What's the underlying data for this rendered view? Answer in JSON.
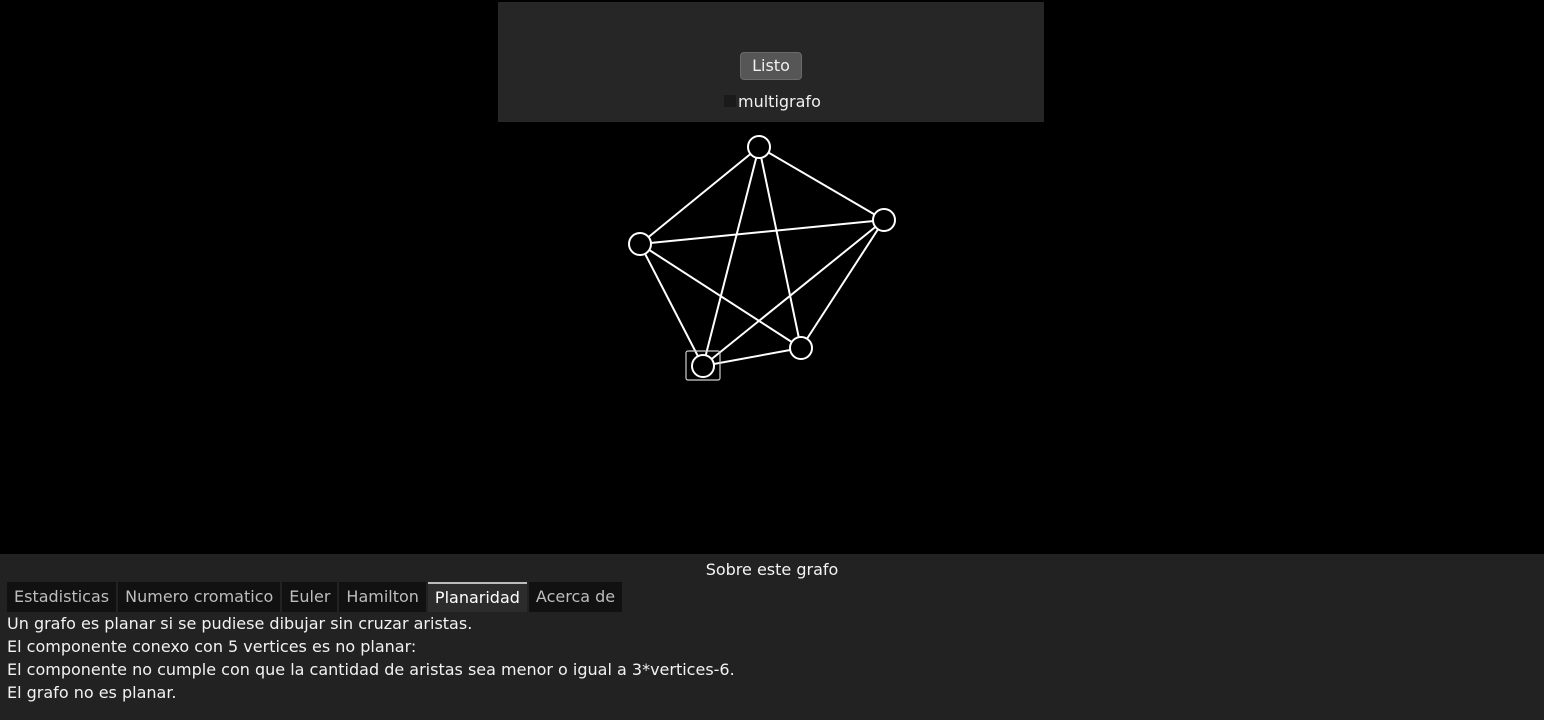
{
  "top_panel": {
    "done_button_label": "Listo",
    "multigraph_label": "multigrafo",
    "multigraph_checked": false
  },
  "bottom_panel": {
    "title": "Sobre este grafo",
    "tabs": [
      {
        "label": "Estadisticas",
        "active": false
      },
      {
        "label": "Numero cromatico",
        "active": false
      },
      {
        "label": "Euler",
        "active": false
      },
      {
        "label": "Hamilton",
        "active": false
      },
      {
        "label": "Planaridad",
        "active": true
      },
      {
        "label": "Acerca de",
        "active": false
      }
    ],
    "content_lines": [
      "Un grafo es planar si se pudiese dibujar sin cruzar aristas.",
      "El componente conexo con 5 vertices es no planar:",
      "El componente no cumple con que la cantidad de aristas sea menor o igual a 3*vertices-6.",
      "El grafo no es planar."
    ]
  },
  "graph": {
    "vertex_count": 5,
    "edges": [
      [
        0,
        1
      ],
      [
        0,
        2
      ],
      [
        0,
        3
      ],
      [
        0,
        4
      ],
      [
        1,
        2
      ],
      [
        1,
        3
      ],
      [
        1,
        4
      ],
      [
        2,
        3
      ],
      [
        2,
        4
      ],
      [
        3,
        4
      ]
    ],
    "selected_vertex": 3,
    "colors": {
      "background": "#000000",
      "edge": "#ffffff",
      "vertex_fill": "#ffffff"
    }
  }
}
